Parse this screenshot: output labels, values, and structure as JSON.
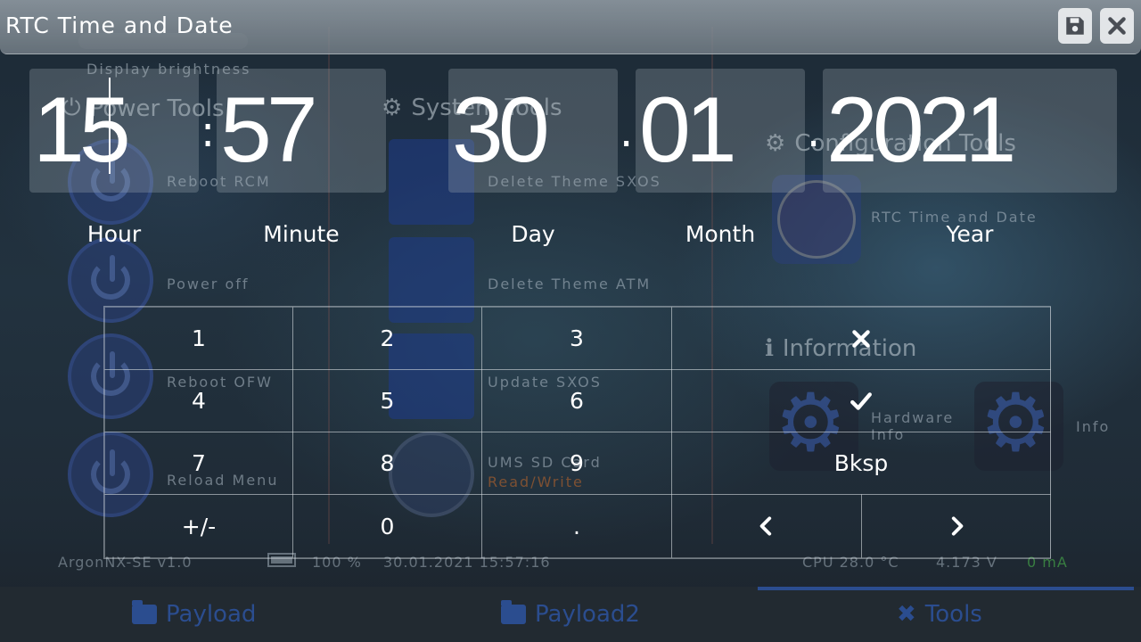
{
  "window": {
    "title": "RTC Time and Date",
    "save_icon": "save-icon",
    "close_icon": "close-icon"
  },
  "fields": [
    {
      "id": "hour",
      "value": "15",
      "label": "Hour"
    },
    {
      "id": "minute",
      "value": "57",
      "label": "Minute"
    },
    {
      "id": "day",
      "value": "30",
      "label": "Day"
    },
    {
      "id": "month",
      "value": "01",
      "label": "Month"
    },
    {
      "id": "year",
      "value": "2021",
      "label": "Year"
    }
  ],
  "separators": {
    "time": ":",
    "date": "."
  },
  "keypad": {
    "k1": "1",
    "k2": "2",
    "k3": "3",
    "k4": "4",
    "k5": "5",
    "k6": "6",
    "k7": "7",
    "k8": "8",
    "k9": "9",
    "sign": "+/-",
    "k0": "0",
    "dot": ".",
    "backspace": "Bksp",
    "cancel_icon": "x-icon",
    "confirm_icon": "check-icon",
    "left_icon": "chevron-left-icon",
    "right_icon": "chevron-right-icon"
  },
  "background": {
    "brightness_label": "Display brightness",
    "sections": {
      "power": "Power Tools",
      "system": "System Tools",
      "config": "Configuration Tools",
      "info": "Information"
    },
    "items": {
      "reboot_rcm": "Reboot RCM",
      "power_off": "Power off",
      "reboot_ofw": "Reboot OFW",
      "reload_menu": "Reload Menu",
      "delete_theme_sxos": "Delete Theme SXOS",
      "delete_theme_atm": "Delete Theme ATM",
      "update_sxos": "Update SXOS",
      "ums_sd_card": "UMS SD Card",
      "read_write": "Read/Write",
      "rtc_time_date": "RTC Time and Date",
      "hardware_info": "Hardware Info",
      "info": "Info"
    },
    "status": {
      "version": "ArgonNX-SE v1.0",
      "battery": "100 %",
      "datetime": "30.01.2021 15:57:16",
      "cpu_temp": "CPU 28.0 °C",
      "voltage": "4.173 V",
      "current": "0 mA"
    },
    "tabs": {
      "payload": "Payload",
      "payload2": "Payload2",
      "tools": "Tools"
    }
  }
}
